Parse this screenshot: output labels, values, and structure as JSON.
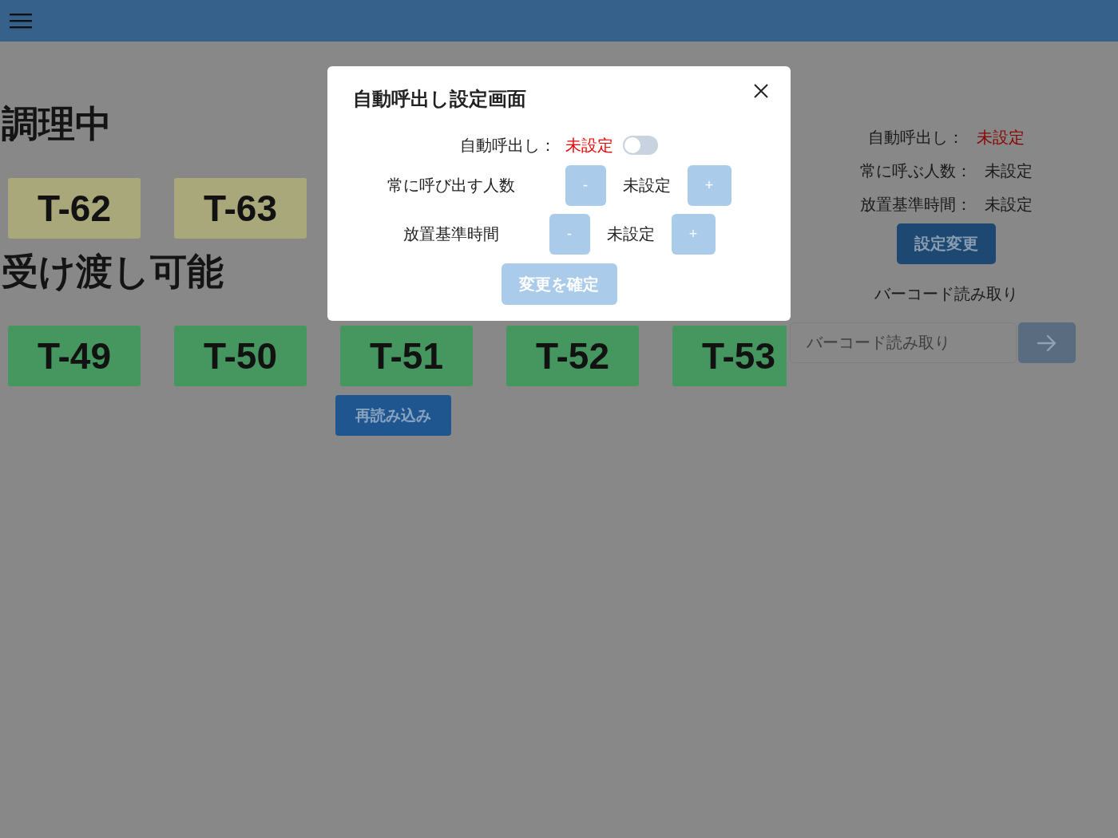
{
  "sections": [
    {
      "title": "調理中",
      "kind": "cooking",
      "tickets": [
        "T-62",
        "T-63"
      ]
    },
    {
      "title": "受け渡し可能",
      "kind": "ready",
      "tickets": [
        "T-49",
        "T-50",
        "T-51",
        "T-52",
        "T-53"
      ]
    }
  ],
  "reload_button": "再読み込み",
  "settings_summary": {
    "rows": [
      {
        "label": "自動呼出し：",
        "value": "未設定",
        "kind": "alert"
      },
      {
        "label": "常に呼ぶ人数：",
        "value": "未設定",
        "kind": "plain"
      },
      {
        "label": "放置基準時間：",
        "value": "未設定",
        "kind": "plain"
      }
    ],
    "change_button": "設定変更"
  },
  "barcode": {
    "label": "バーコード読み取り",
    "placeholder": "バーコード読み取り"
  },
  "modal": {
    "title": "自動呼出し設定画面",
    "auto_call": {
      "label": "自動呼出し：",
      "value": "未設定",
      "on": false
    },
    "steppers": [
      {
        "label": "常に呼び出す人数",
        "minus": "-",
        "value": "未設定",
        "plus": "+",
        "disabled": true
      },
      {
        "label": "放置基準時間",
        "minus": "-",
        "value": "未設定",
        "plus": "+",
        "disabled": true
      }
    ],
    "confirm_button": {
      "label": "変更を確定",
      "disabled": true
    }
  }
}
